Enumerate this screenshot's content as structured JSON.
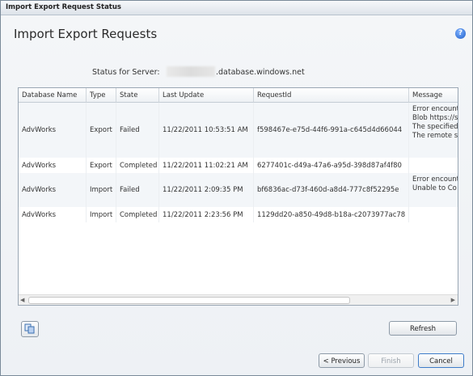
{
  "window": {
    "title": "Import Export Request Status"
  },
  "heading": "Import Export Requests",
  "help_icon": "help-icon",
  "status": {
    "label": "Status for Server:",
    "server_suffix": ".database.windows.net"
  },
  "grid": {
    "columns": [
      "Database Name",
      "Type",
      "State",
      "Last Update",
      "RequestId",
      "Message"
    ],
    "rows": [
      {
        "database": "AdvWorks",
        "type": "Export",
        "state": "Failed",
        "last_update": "11/22/2011 10:53:51 AM",
        "request_id": "f598467e-e75d-44f6-991a-c645d4d66044",
        "message": [
          "Error encount",
          "Blob https://s",
          "The specified",
          "The remote s"
        ]
      },
      {
        "database": "AdvWorks",
        "type": "Export",
        "state": "Completed",
        "last_update": "11/22/2011 11:02:21 AM",
        "request_id": "6277401c-d49a-47a6-a95d-398d87af4f80",
        "message": []
      },
      {
        "database": "AdvWorks",
        "type": "Import",
        "state": "Failed",
        "last_update": "11/22/2011 2:09:35 PM",
        "request_id": "bf6836ac-d73f-460d-a8d4-777c8f52295e",
        "message": [
          "Error encount",
          "Unable to Co"
        ]
      },
      {
        "database": "AdvWorks",
        "type": "Import",
        "state": "Completed",
        "last_update": "11/22/2011 2:23:56 PM",
        "request_id": "1129dd20-a850-49d8-b18a-c2073977ac78",
        "message": []
      }
    ]
  },
  "buttons": {
    "refresh": "Refresh",
    "previous": "< Previous",
    "finish": "Finish",
    "cancel": "Cancel"
  },
  "copy_icon": "copy-icon"
}
